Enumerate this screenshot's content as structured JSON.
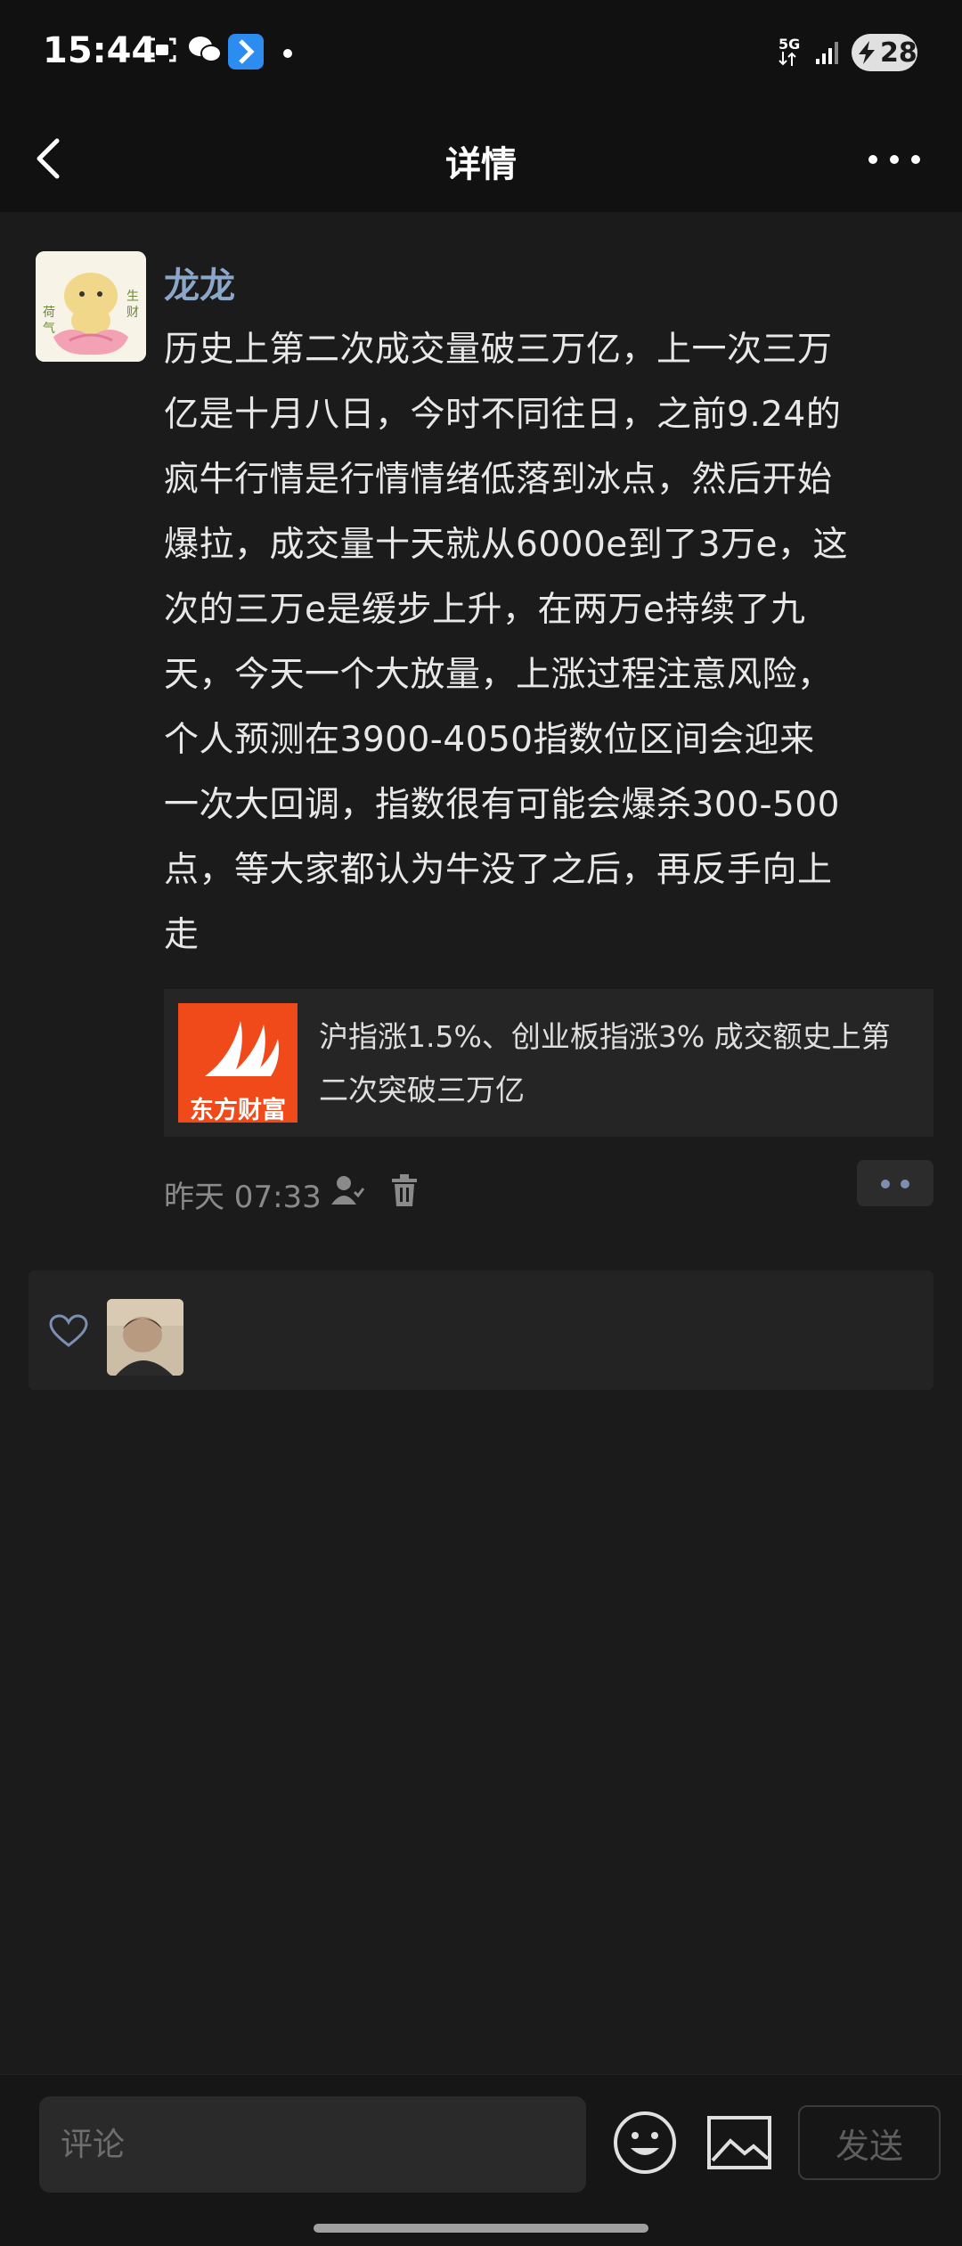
{
  "status_bar": {
    "time": "15:44",
    "network": "5G",
    "battery": "28"
  },
  "nav": {
    "title": "详情"
  },
  "post": {
    "author": "龙龙",
    "avatar_text": [
      "荷",
      "气",
      "生",
      "财"
    ],
    "text_lines": [
      "历史上第二次成交量破三万亿，上一次三万",
      "亿是十月八日，今时不同往日，之前9.24的",
      "疯牛行情是行情情绪低落到冰点，然后开始",
      "爆拉，成交量十天就从6000e到了3万e，这",
      "次的三万e是缓步上升，在两万e持续了九",
      "天，今天一个大放量，上涨过程注意风险，",
      "个人预测在3900-4050指数位区间会迎来",
      "一次大回调，指数很有可能会爆杀300-500",
      "点，等大家都认为牛没了之后，再反手向上",
      "走"
    ],
    "link_card": {
      "source_logo_text": "东方财富",
      "title_lines": [
        "沪指涨1.5%、创业板指涨3% 成交额史上第",
        "二次突破三万亿"
      ]
    },
    "time": "昨天 07:33"
  },
  "colors": {
    "background": "#1b1b1b",
    "author_name": "#8ba6c9",
    "brand_logo": "#f04a1a",
    "icon_blue": "#7b90b0"
  },
  "bottom_bar": {
    "comment_placeholder": "评论",
    "send_label": "发送"
  }
}
